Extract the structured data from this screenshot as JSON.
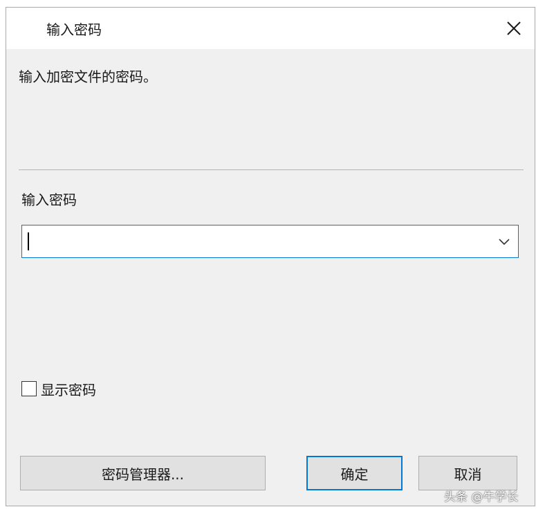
{
  "dialog": {
    "title": "输入密码",
    "close_icon": "close-icon",
    "instruction": "输入加密文件的密码。",
    "password_label": "输入密码",
    "password_value": "",
    "dropdown_icon": "chevron-down-icon",
    "show_password_label": "显示密码",
    "show_password_checked": false,
    "buttons": {
      "manager": "密码管理器...",
      "ok": "确定",
      "cancel": "取消"
    },
    "accent_color": "#0078d7"
  },
  "watermark": "头条 @牛学长"
}
